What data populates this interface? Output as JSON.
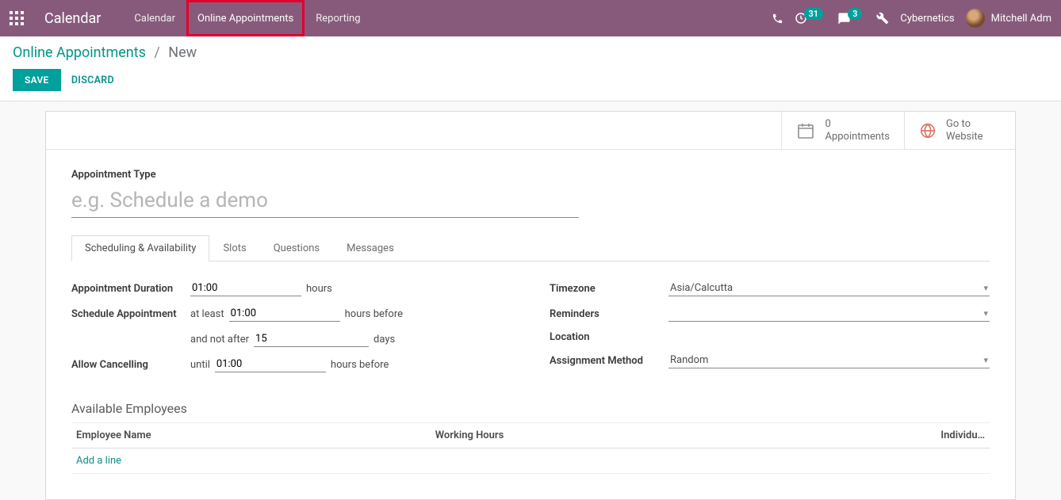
{
  "nav": {
    "brand": "Calendar",
    "items": [
      "Calendar",
      "Online Appointments",
      "Reporting"
    ],
    "clock_badge": "31",
    "chat_badge": "3",
    "company": "Cybernetics",
    "user": "Mitchell Adm"
  },
  "breadcrumb": {
    "parent": "Online Appointments",
    "current": "New"
  },
  "buttons": {
    "save": "SAVE",
    "discard": "DISCARD"
  },
  "stats": {
    "appts_count": "0",
    "appts_label": "Appointments",
    "website_line1": "Go to",
    "website_line2": "Website"
  },
  "form": {
    "type_label": "Appointment Type",
    "type_placeholder": "e.g. Schedule a demo",
    "tabs": [
      "Scheduling & Availability",
      "Slots",
      "Questions",
      "Messages"
    ],
    "left": {
      "duration_label": "Appointment Duration",
      "duration_value": "01:00",
      "duration_unit": "hours",
      "schedule_label": "Schedule Appointment",
      "schedule_atleast": "at least",
      "schedule_atleast_value": "01:00",
      "schedule_atleast_unit": "hours before",
      "schedule_notafter": "and not after",
      "schedule_notafter_value": "15",
      "schedule_notafter_unit": "days",
      "cancel_label": "Allow Cancelling",
      "cancel_until": "until",
      "cancel_value": "01:00",
      "cancel_unit": "hours before"
    },
    "right": {
      "timezone_label": "Timezone",
      "timezone_value": "Asia/Calcutta",
      "reminders_label": "Reminders",
      "reminders_value": "",
      "location_label": "Location",
      "assignment_label": "Assignment Method",
      "assignment_value": "Random"
    },
    "employees": {
      "heading": "Available Employees",
      "col_name": "Employee Name",
      "col_hours": "Working Hours",
      "col_indiv": "Individu…",
      "add_line": "Add a line"
    }
  }
}
